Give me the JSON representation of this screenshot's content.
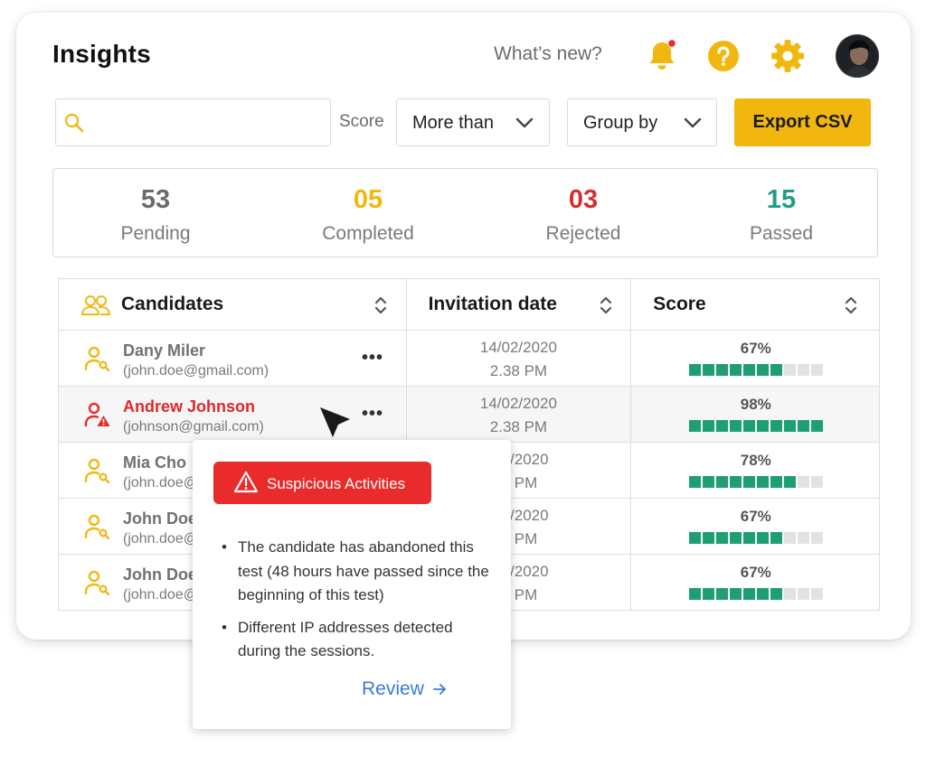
{
  "header": {
    "title": "Insights",
    "whats_new": "What’s new?"
  },
  "toolbar": {
    "search_placeholder": "",
    "score_label": "Score",
    "score_filter": "More than",
    "group_by": "Group by",
    "export_label": "Export CSV"
  },
  "stats": [
    {
      "value": "53",
      "label": "Pending",
      "color": "#6b6b6b"
    },
    {
      "value": "05",
      "label": "Completed",
      "color": "#f2b70f"
    },
    {
      "value": "03",
      "label": "Rejected",
      "color": "#d32f2f"
    },
    {
      "value": "15",
      "label": "Passed",
      "color": "#1e9e8a"
    }
  ],
  "table": {
    "headers": [
      "Candidates",
      "Invitation date",
      "Score"
    ],
    "rows": [
      {
        "name": "Dany Miler",
        "email": "(john.doe@gmail.com)",
        "date": "14/02/2020",
        "time": "2.38 PM",
        "score": "67%",
        "score_fraction": 0.67,
        "flagged": false
      },
      {
        "name": "Andrew Johnson",
        "email": "(johnson@gmail.com)",
        "date": "14/02/2020",
        "time": "2.38 PM",
        "score": "98%",
        "score_fraction": 0.98,
        "flagged": true
      },
      {
        "name": "Mia Cho",
        "email": "(john.doe@",
        "date": "2/2020",
        "time": "8 PM",
        "score": "78%",
        "score_fraction": 0.78,
        "flagged": false
      },
      {
        "name": "John Doe",
        "email": "(john.doe@",
        "date": "2/2020",
        "time": "8 PM",
        "score": "67%",
        "score_fraction": 0.67,
        "flagged": false
      },
      {
        "name": "John Doe",
        "email": "(john.doe@",
        "date": "2/2020",
        "time": "8 PM",
        "score": "67%",
        "score_fraction": 0.67,
        "flagged": false
      }
    ]
  },
  "popup": {
    "badge": "Suspicious Activities",
    "items": [
      "The candidate has abandoned this test (48 hours have passed since the beginning of this test)",
      "Different IP addresses detected during the sessions."
    ],
    "review": "Review"
  },
  "colors": {
    "accent": "#f2b70f",
    "danger": "#e92b2b",
    "score_bar": "#1e9e73",
    "link": "#3a7bd5"
  }
}
